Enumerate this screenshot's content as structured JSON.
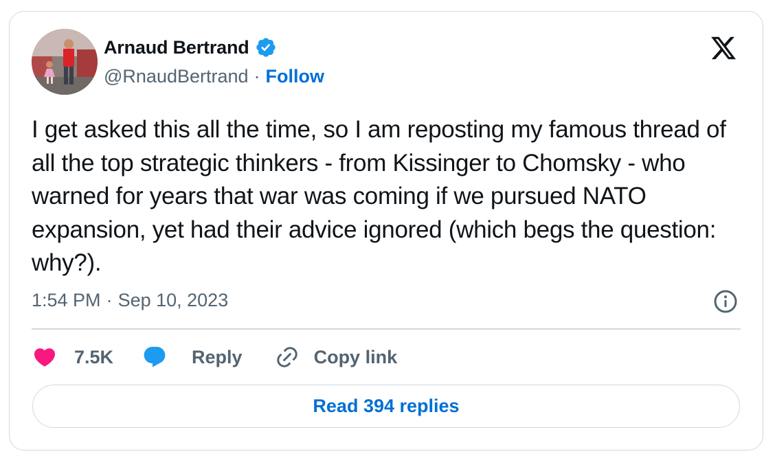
{
  "author": {
    "name": "Arnaud Bertrand",
    "handle": "@RnaudBertrand",
    "separator": "·",
    "follow_label": "Follow",
    "verified_icon": "verified-badge-icon",
    "avatar_icon": "profile-photo"
  },
  "brand": {
    "logo": "x-logo-icon"
  },
  "tweet": {
    "text": "I get asked this all the time, so I am reposting my famous thread of all the top strategic thinkers - from Kissinger to Chomsky - who warned for years that war was coming if we pursued NATO expansion, yet had their advice ignored (which begs the question: why?).",
    "time": "1:54 PM",
    "separator": "·",
    "date": "Sep 10, 2023",
    "info_icon": "info-icon"
  },
  "actions": {
    "likes": "7.5K",
    "reply_label": "Reply",
    "copy_label": "Copy link"
  },
  "read_replies_label": "Read 394 replies",
  "colors": {
    "text": "#0f1419",
    "secondary": "#536471",
    "link": "#006fd6",
    "verified": "#1d9bf0",
    "like": "#f91880",
    "reply": "#1d9bf0",
    "border": "#cfd9de"
  }
}
